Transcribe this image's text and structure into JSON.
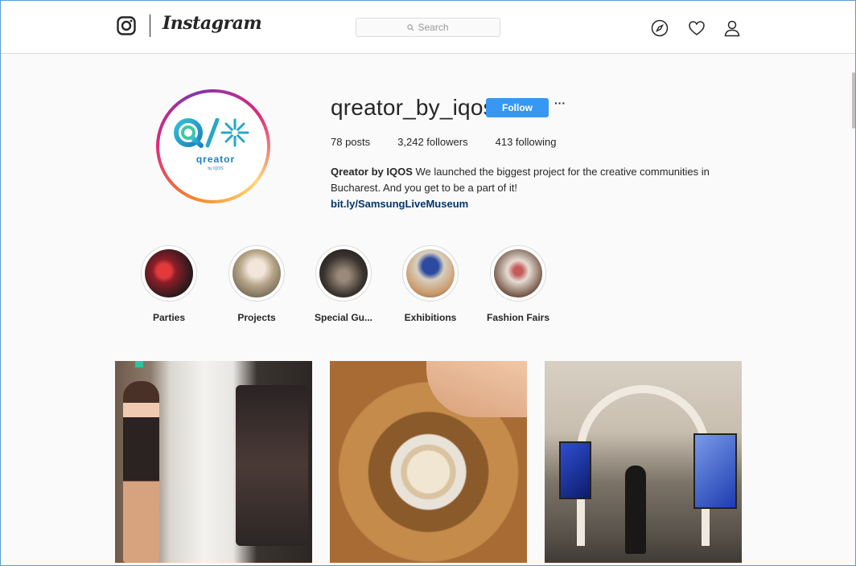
{
  "header": {
    "brand": "Instagram",
    "search_placeholder": "Search"
  },
  "profile": {
    "username": "qreator_by_iqos",
    "follow_label": "Follow",
    "more_label": "···",
    "avatar_text": "qreator",
    "avatar_subtext": "by IQOS",
    "stats": {
      "posts": "78 posts",
      "followers": "3,242 followers",
      "following": "413 following"
    },
    "bio_name": "Qreator by IQOS",
    "bio_text": " We launched the biggest project for the creative communities in Bucharest. And you get to be a part of it!",
    "bio_link": "bit.ly/SamsungLiveMuseum"
  },
  "highlights": [
    {
      "label": "Parties",
      "color": "#8a1e28"
    },
    {
      "label": "Projects",
      "color": "#b8a58a"
    },
    {
      "label": "Special Gu...",
      "color": "#3a3430"
    },
    {
      "label": "Exhibitions",
      "color": "#2b4aa0"
    },
    {
      "label": "Fashion Fairs",
      "color": "#6a4a3a"
    }
  ],
  "colors": {
    "accent": "#3897f0",
    "link": "#003569"
  }
}
